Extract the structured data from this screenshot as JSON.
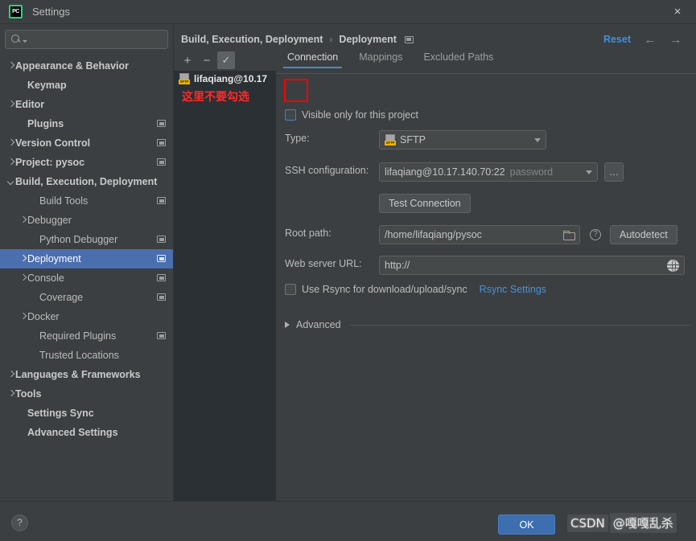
{
  "window": {
    "title": "Settings",
    "logo_text": "PC",
    "close_icon": "×"
  },
  "sidebar": {
    "search": {
      "value": "",
      "placeholder": ""
    },
    "items": [
      {
        "label": "Appearance & Behavior",
        "indent": 0,
        "arrow": "right",
        "bold": true,
        "badge": false,
        "selected": false
      },
      {
        "label": "Keymap",
        "indent": 1,
        "arrow": "none",
        "bold": true,
        "badge": false,
        "selected": false
      },
      {
        "label": "Editor",
        "indent": 0,
        "arrow": "right",
        "bold": true,
        "badge": false,
        "selected": false
      },
      {
        "label": "Plugins",
        "indent": 1,
        "arrow": "none",
        "bold": true,
        "badge": true,
        "selected": false
      },
      {
        "label": "Version Control",
        "indent": 0,
        "arrow": "right",
        "bold": true,
        "badge": true,
        "selected": false
      },
      {
        "label": "Project: pysoc",
        "indent": 0,
        "arrow": "right",
        "bold": true,
        "badge": true,
        "selected": false
      },
      {
        "label": "Build, Execution, Deployment",
        "indent": 0,
        "arrow": "down",
        "bold": true,
        "badge": false,
        "selected": false
      },
      {
        "label": "Build Tools",
        "indent": 2,
        "arrow": "none",
        "bold": false,
        "badge": true,
        "selected": false
      },
      {
        "label": "Debugger",
        "indent": 1,
        "arrow": "right",
        "bold": false,
        "badge": false,
        "selected": false
      },
      {
        "label": "Python Debugger",
        "indent": 2,
        "arrow": "none",
        "bold": false,
        "badge": true,
        "selected": false
      },
      {
        "label": "Deployment",
        "indent": 1,
        "arrow": "right",
        "bold": false,
        "badge": true,
        "selected": true
      },
      {
        "label": "Console",
        "indent": 1,
        "arrow": "right",
        "bold": false,
        "badge": true,
        "selected": false
      },
      {
        "label": "Coverage",
        "indent": 2,
        "arrow": "none",
        "bold": false,
        "badge": true,
        "selected": false
      },
      {
        "label": "Docker",
        "indent": 1,
        "arrow": "right",
        "bold": false,
        "badge": false,
        "selected": false
      },
      {
        "label": "Required Plugins",
        "indent": 2,
        "arrow": "none",
        "bold": false,
        "badge": true,
        "selected": false
      },
      {
        "label": "Trusted Locations",
        "indent": 2,
        "arrow": "none",
        "bold": false,
        "badge": false,
        "selected": false
      },
      {
        "label": "Languages & Frameworks",
        "indent": 0,
        "arrow": "right",
        "bold": true,
        "badge": false,
        "selected": false
      },
      {
        "label": "Tools",
        "indent": 0,
        "arrow": "right",
        "bold": true,
        "badge": false,
        "selected": false
      },
      {
        "label": "Settings Sync",
        "indent": 1,
        "arrow": "none",
        "bold": true,
        "badge": false,
        "selected": false
      },
      {
        "label": "Advanced Settings",
        "indent": 1,
        "arrow": "none",
        "bold": true,
        "badge": false,
        "selected": false
      }
    ]
  },
  "main": {
    "breadcrumb": {
      "root": "Build, Execution, Deployment",
      "separator": "›",
      "leaf": "Deployment"
    },
    "reset_label": "Reset",
    "nav_back_icon": "←",
    "nav_forward_icon": "→",
    "toolbar": {
      "add_label": "+",
      "remove_label": "−",
      "default_label": "✓"
    },
    "server_list": {
      "items": [
        {
          "name": "lifaqiang@10.17",
          "type_badge": "SFTP"
        }
      ],
      "annotation": "这里不要勾选"
    },
    "tabs": [
      {
        "label": "Connection",
        "active": true
      },
      {
        "label": "Mappings",
        "active": false
      },
      {
        "label": "Excluded Paths",
        "active": false
      }
    ],
    "form": {
      "visible_only_label": "Visible only for this project",
      "visible_only_checked": false,
      "type_label": "Type:",
      "type_value": "SFTP",
      "type_badge": "SFTP",
      "ssh_config_label": "SSH configuration:",
      "ssh_config_value": "lifaqiang@10.17.140.70:22",
      "ssh_config_hint": "password",
      "ssh_browse_label": "…",
      "test_connection_label": "Test Connection",
      "root_path_label": "Root path:",
      "root_path_value": "/home/lifaqiang/pysoc",
      "root_path_help": "?",
      "autodetect_label": "Autodetect",
      "web_url_label": "Web server URL:",
      "web_url_value": "http://",
      "rsync_label": "Use Rsync for download/upload/sync",
      "rsync_checked": false,
      "rsync_settings_link": "Rsync Settings",
      "advanced_label": "Advanced"
    }
  },
  "footer": {
    "help_label": "?",
    "ok_label": "OK",
    "watermark_left": "CSDN",
    "watermark_right": "@嘎嘎乱杀"
  },
  "colors": {
    "accent_blue": "#4b6eaf",
    "link_blue": "#4a90d9",
    "reset_blue": "#3f8fe0",
    "annotation_red": "#ff0000",
    "panel_bg": "#3c3f41",
    "list_bg": "#2b3034"
  }
}
